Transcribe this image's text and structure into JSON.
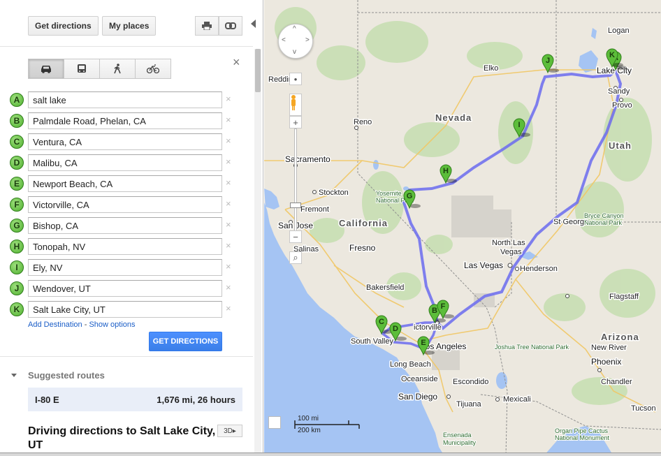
{
  "toolbar": {
    "get_directions_label": "Get directions",
    "my_places_label": "My places",
    "print_icon": "printer-icon",
    "link_icon": "link-icon"
  },
  "travel_modes": [
    {
      "name": "driving",
      "icon": "car-icon",
      "active": true
    },
    {
      "name": "transit",
      "icon": "bus-icon",
      "active": false
    },
    {
      "name": "walking",
      "icon": "walk-icon",
      "active": false
    },
    {
      "name": "bicycling",
      "icon": "bike-icon",
      "active": false
    }
  ],
  "close_label": "×",
  "waypoints": [
    {
      "letter": "A",
      "value": "salt lake"
    },
    {
      "letter": "B",
      "value": "Palmdale Road, Phelan, CA"
    },
    {
      "letter": "C",
      "value": "Ventura, CA"
    },
    {
      "letter": "D",
      "value": "Malibu, CA"
    },
    {
      "letter": "E",
      "value": "Newport Beach, CA"
    },
    {
      "letter": "F",
      "value": "Victorville, CA"
    },
    {
      "letter": "G",
      "value": "Bishop, CA"
    },
    {
      "letter": "H",
      "value": "Tonopah, NV"
    },
    {
      "letter": "I",
      "value": "Ely, NV"
    },
    {
      "letter": "J",
      "value": "Wendover, UT"
    },
    {
      "letter": "K",
      "value": "Salt Lake City, UT"
    }
  ],
  "remove_label": "×",
  "links": {
    "add_destination": "Add Destination",
    "separator": " - ",
    "show_options": "Show options"
  },
  "get_directions_button": "GET DIRECTIONS",
  "suggested": {
    "title": "Suggested routes",
    "route_name": "I-80 E",
    "route_info": "1,676 mi, 26 hours"
  },
  "directions_title": "Driving directions to Salt Lake City, UT",
  "btn_3d": "3D▸",
  "map": {
    "route_color": "#6b6bf0",
    "marker_color": "#5cbd3a",
    "states": [
      "Nevada",
      "California",
      "Utah",
      "Arizona"
    ],
    "cities": [
      "Logan",
      "Lake City",
      "Sandy",
      "Provo",
      "Elko",
      "Reddin",
      "Reno",
      "Sacramento",
      "Stockton",
      "Fremont",
      "San Jose",
      "Salinas",
      "Fresno",
      "Bakersfield",
      "Yosemite National Park",
      "South Valley",
      "Los Angeles",
      "Long Beach",
      "Oceanside",
      "Escondido",
      "San Diego",
      "Tijuana",
      "Mexicali",
      "Ensenada Municipality",
      "Las Vegas",
      "North Las Vegas",
      "Henderson",
      "St George",
      "Bryce Canyon National Park",
      "Flagstaff",
      "New River",
      "Phoenix",
      "Chandler",
      "Tucson",
      "Joshua Tree National Park",
      "Organ Pipe Cactus National Monument",
      "Victorville"
    ],
    "scale_top": "100 mi",
    "scale_bottom": "200 km"
  }
}
